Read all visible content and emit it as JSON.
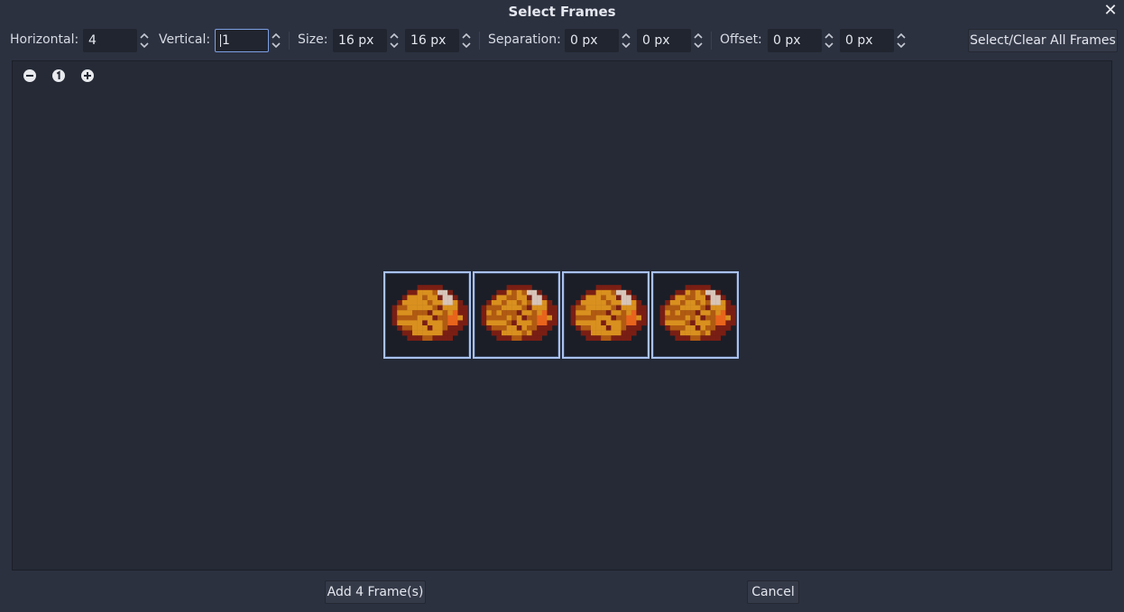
{
  "dialog": {
    "title": "Select Frames",
    "close_glyph": "✕"
  },
  "toolbar": {
    "horizontal": {
      "label": "Horizontal:",
      "value": "4"
    },
    "vertical": {
      "label": "Vertical:",
      "value": "1"
    },
    "size": {
      "label": "Size:",
      "x": "16 px",
      "y": "16 px"
    },
    "separation": {
      "label": "Separation:",
      "x": "0 px",
      "y": "0 px"
    },
    "offset": {
      "label": "Offset:",
      "x": "0 px",
      "y": "0 px"
    },
    "select_clear_label": "Select/Clear All Frames"
  },
  "zoom": {
    "out_glyph": "−",
    "reset_glyph": "1",
    "in_glyph": "+"
  },
  "frames": {
    "count": 4,
    "selected": [
      true,
      true,
      true,
      true
    ]
  },
  "footer": {
    "add_label": "Add 4 Frame(s)",
    "cancel_label": "Cancel"
  },
  "colors": {
    "background": "#2c3140",
    "canvas": "#252a36",
    "frame_border": "#a9c1ee",
    "sprite_dark": "#7a1e14",
    "sprite_mid": "#b05a12",
    "sprite_light": "#d9901e",
    "sprite_accent": "#e8641c",
    "sprite_highlight": "#d8c4b8"
  }
}
